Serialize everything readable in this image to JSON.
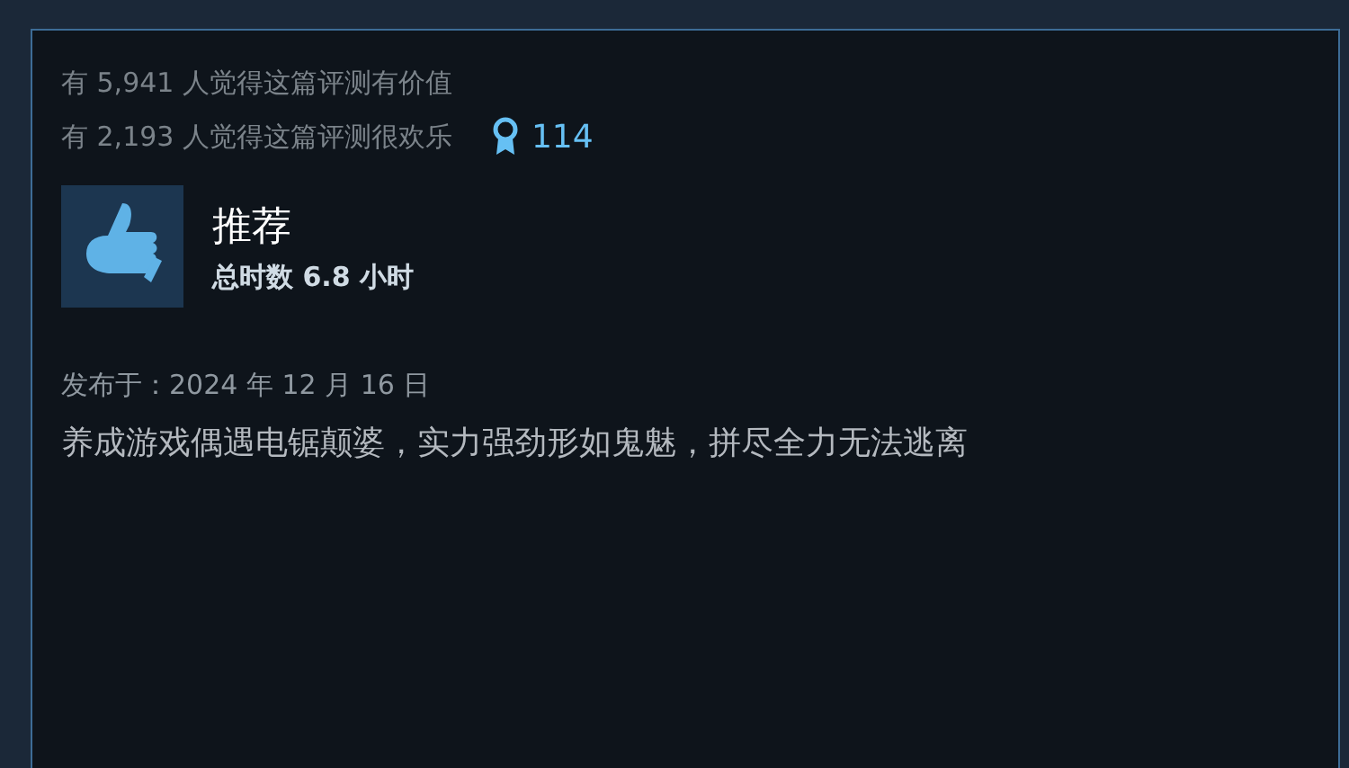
{
  "votes": {
    "helpful": "有 5,941 人觉得这篇评测有价值",
    "funny": "有 2,193 人觉得这篇评测很欢乐",
    "awards": "114"
  },
  "review": {
    "recommended": true,
    "verdict": "推荐",
    "playtime": "总时数 6.8 小时",
    "posted": "发布于：2024 年 12 月 16 日",
    "text": "养成游戏偶遇电锯颠婆，实力强劲形如鬼魅，拼尽全力无法逃离"
  }
}
